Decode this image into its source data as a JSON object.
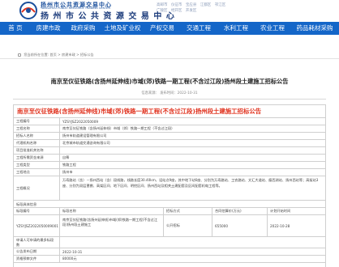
{
  "header": {
    "brand_cn": "扬州市公共资源交易中心",
    "brand_en": "YANGZHOU PUBLIC RESOURCE TRADING CENTER",
    "brand_main": "扬 州 市 公 共 资 源 交 易 中 心",
    "region_links": [
      "高邮市",
      "仪征市",
      "宝应县",
      "江都区",
      "邗江区",
      "广陵区",
      "经开区",
      "开发区"
    ]
  },
  "nav": {
    "items": [
      "首 页",
      "房建市政",
      "政府采购",
      "土地及矿业权",
      "产权交易",
      "交通工程",
      "水利工程",
      "农业工程",
      "药品耗材采购"
    ]
  },
  "breadcrumb": {
    "items": [
      "您当前所在位置:",
      "首页",
      ">",
      "房建市政",
      ">",
      "招标公告"
    ]
  },
  "page": {
    "title": "南京至仪征铁路(含扬州延伸线)市域(郊)铁路一期工程(不含过江段)扬州段土建施工招标公告",
    "meta": "信息来源： 发布时间：2022-10-31"
  },
  "notice": {
    "title": "南京至仪征铁路(含扬州延伸线)市域(郊)铁路一期工程(不含过江段)扬州段土建施工招标公告",
    "rows": [
      {
        "label": "工程编号",
        "value": "YZSYJSZ2022050009"
      },
      {
        "label": "工程名称",
        "value": "南京至仪征铁路（含扬州延伸线）市域（郊）铁路一期工程（不含过江段）"
      },
      {
        "label": "招标人名称",
        "value": "扬州市轨道建设管理有限公司"
      },
      {
        "label": "代理机构名称",
        "value": "北京城市轨道交通咨询有限公司"
      },
      {
        "label": "项目批准机关名称",
        "value": ""
      },
      {
        "label": "工程所需资金来源",
        "value": "自筹"
      },
      {
        "label": "工程类型",
        "value": "铁路工程"
      },
      {
        "label": "工程地点",
        "value": "扬州市"
      },
      {
        "label": "工程概况",
        "value": "万寿路站（含）－扬州西站（含）段线路，线路长度30.40km，设站点9座，其中地下站6座、分别为万寿路站、工农路站、文汇大道站、瘦西湖站、扬州西站等；高架站3座、分别为双层罩棚、高架区间、地下区间、明挖区间、扬州西站及相关土建配套及区间配套机电工程等。"
      },
      {
        "label": "标段具体信息",
        "value": ""
      }
    ],
    "section_table": {
      "headers": [
        "标段编号",
        "标段名称",
        "招标方式",
        "合同估算价(万元)",
        "计划开始时间"
      ],
      "rows": [
        [
          "YZSYJSZ2022050009001",
          "南京至仪征铁路(含扬州延伸线)市域(郊)铁路一期工程(不含过江段)扬州段土建施工",
          "公开招标",
          "655000",
          "2022-10-28"
        ]
      ]
    },
    "tail_rows": [
      {
        "label": "申请人可申请的最多标段数",
        "value": ""
      },
      {
        "label": "公告发布日期",
        "value": "2022-10-31"
      },
      {
        "label": "资格预审文件",
        "value": "80000元"
      }
    ]
  }
}
